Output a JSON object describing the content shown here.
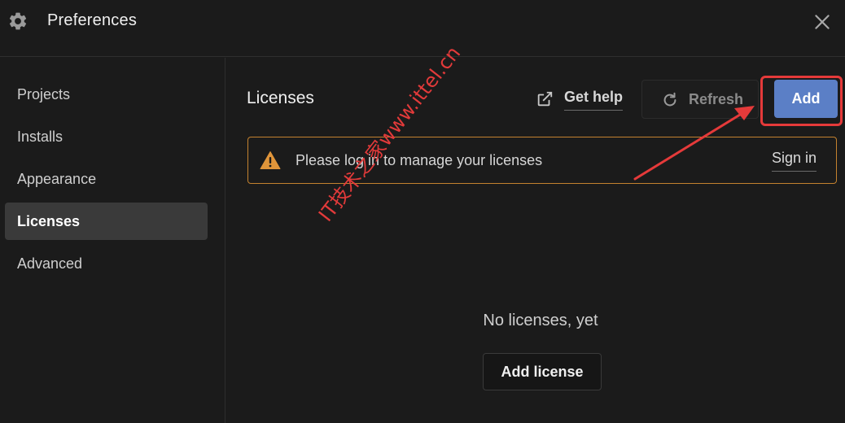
{
  "window": {
    "title": "Preferences",
    "icons": {
      "settings": "gear-icon",
      "close": "close-icon"
    }
  },
  "sidebar": {
    "items": [
      {
        "label": "Projects",
        "active": false
      },
      {
        "label": "Installs",
        "active": false
      },
      {
        "label": "Appearance",
        "active": false
      },
      {
        "label": "Licenses",
        "active": true
      },
      {
        "label": "Advanced",
        "active": false
      }
    ]
  },
  "main": {
    "title": "Licenses",
    "get_help": {
      "label": "Get help",
      "icon": "external-link-icon"
    },
    "refresh": {
      "label": "Refresh",
      "icon": "refresh-icon",
      "enabled": false
    },
    "add": {
      "label": "Add"
    },
    "banner": {
      "icon": "warning-icon",
      "message": "Please log in to manage your licenses",
      "sign_in": "Sign in"
    },
    "empty_state": {
      "message": "No licenses, yet",
      "button": "Add license"
    }
  },
  "annotation": {
    "watermark": "IT技术之家www.ittel.cn"
  },
  "colors": {
    "background": "#1b1b1b",
    "accent": "#5b7fc6",
    "warning_border": "#c4822f",
    "warning_icon": "#e0953a",
    "annotation": "#e53a3a"
  }
}
